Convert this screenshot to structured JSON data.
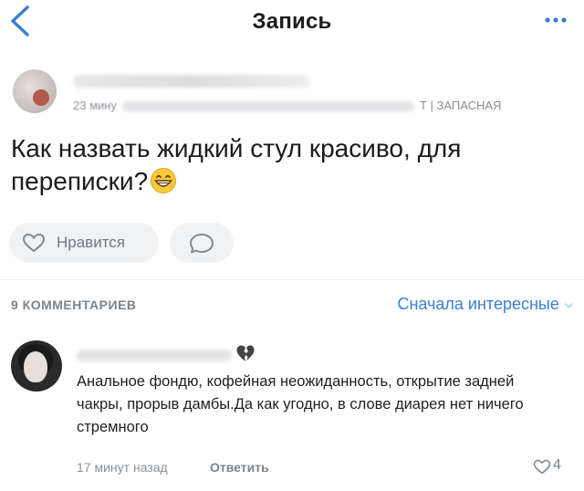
{
  "header": {
    "title": "Запись",
    "back_icon": "chevron-left-icon",
    "more_icon": "more-dots-icon",
    "accent_color": "#3a7fd1"
  },
  "post": {
    "meta_time": "23 мину",
    "meta_suffix": "Т | ЗАПАСНАЯ",
    "text": "Как назвать жидкий стул красиво, для переписки?",
    "like_label": "Нравится"
  },
  "comments_section": {
    "count_label": "9 КОММЕНТАРИЕВ",
    "sort_label": "Сначала интересные"
  },
  "comment": {
    "text": "Анальное фондю, кофейная неожиданность, открытие задней чакры, прорыв дамбы.Да как угодно, в слове диарея нет ничего стремного",
    "time": "17 минут назад",
    "reply_label": "Ответить",
    "like_count": "4"
  }
}
